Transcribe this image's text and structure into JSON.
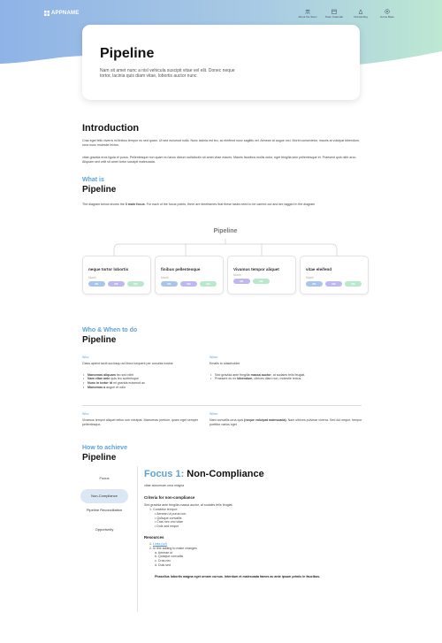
{
  "brand": {
    "name": "APPNAME"
  },
  "nav": [
    {
      "label": "About the Team",
      "icon": "team-icon"
    },
    {
      "label": "Team Calendar",
      "icon": "calendar-icon"
    },
    {
      "label": "Onboarding",
      "icon": "onboarding-icon"
    },
    {
      "label": "Home Base",
      "icon": "home-base-icon"
    }
  ],
  "colors": {
    "hero_start": "#8fb3e6",
    "hero_end": "#bde8d2",
    "accent": "#5ba3d6",
    "pill_m1": "#a8c6ec",
    "pill_m2": "#bdb8f0",
    "pill_m3": "#b9e8cd"
  },
  "hero": {
    "title": "Pipeline",
    "subtitle": "Nam sit amet nunc a nisl vehicula suscipit vitae vel elit. Donec neque tortor, lacinia quis diam vitae, lobortis auctor nunc"
  },
  "intro": {
    "heading": "Introduction",
    "p1": "Cras eget felis viverra mi finibus tempor eu sed quam. Ut sed euismod nulla. Nunc lacinia est leo, ac eleifend nunc sagittis vel. Aenean at augue orci. Morbi consectetur, mauris at volutpat bibendum, urna nunc molestie lectus.",
    "p2": "vitae gravida eros ligula et purus. Pellentesque non quam eu lacus dictum sollicitudin sit amet vitae mauris. Mauris faucibus mollis dolor, eget fringilla sem pellentesque et. Praesent quis nibh arcu. Aliquam sed velit sit amet tortor suscipit malesuada."
  },
  "what": {
    "eyebrow": "What is",
    "heading": "Pipeline",
    "desc_pre": "The diagram below shows the ",
    "desc_bold": "3 main focus",
    "desc_post": ". For each of the focus points, there are timeframes that these tasks need to be carried out and are tagged in the diagram",
    "tree_title": "Pipeline",
    "month_label": "Month",
    "focus": [
      {
        "title": "neque tortor lobortis",
        "pills": [
          "M1",
          "M2",
          "M3"
        ]
      },
      {
        "title": "finibus pellentesque",
        "pills": [
          "M1",
          "M2",
          "M3"
        ]
      },
      {
        "title": "Vivamus tempor aliquet",
        "pills": [
          "M1",
          "M2"
        ]
      },
      {
        "title": "vitae eleifend",
        "pills": [
          "M1",
          "M2",
          "M3"
        ]
      }
    ]
  },
  "who": {
    "eyebrow": "Who & When to do",
    "heading": "Pipeline",
    "left1": {
      "label": "Who:",
      "text": "Class aptent taciti sociosqu ad litora torquent per conubia nostra:",
      "bullets": [
        {
          "bold": "Maecenas aliquam",
          "rest": " leo sed nibh"
        },
        {
          "bold": "Nam vitae ante",
          "rest": " quis leo scelerisque"
        },
        {
          "bold": "Nunc in tortor id",
          "rest": " mi gravida euismod ac"
        },
        {
          "bold": "Maecenas a",
          "rest": " augue et odio"
        }
      ]
    },
    "right1": {
      "label": "When:",
      "text": "Emails to stakeholder",
      "b1_pre": "Sed gravida ante fringilla ",
      "b1_bold": "massa auctor",
      "b1_post": ", at sodales felis feugiat.",
      "b2_pre": "Praesent eu ex ",
      "b2_bold": "bibendum",
      "b2_post": ", ultrices diam non, molestie lectus."
    },
    "left2": {
      "label": "Who:",
      "text": "Vivamus tempor aliquet tellus non volutpat. Maecenas pretium, quam eget semper pellentesque,"
    },
    "right2": {
      "label": "When:",
      "pre": "Nam convallis urna quis ",
      "bold": "(neque volutpat malesuada)",
      "post": ". Nam ultrices pulvinar viverra. Sed dui neque, tempor porttitor varius eget"
    }
  },
  "how": {
    "eyebrow": "How to achieve",
    "heading": "Pipeline",
    "sidenav": [
      "Focus",
      "Non-Compliance",
      "Pipeline Reconciliation",
      "Opportunity"
    ],
    "detail": {
      "title_accent": "Focus 1:",
      "title_rest": " Non-Compliance",
      "intro": "vitae accumsan urna magna",
      "criteria_heading": "Criteria for non-compliance",
      "criteria_text": "Sed gravida ante fringilla massa auctor, at sodales felis feugiat.",
      "criteria_list": [
        "1. Curabitur tempor:"
      ],
      "sub_list": [
        "Aenean ut purus non",
        "Quisque convallis",
        "Cras nec orci vitae",
        "Duis sed neque"
      ],
      "resources_heading": "Resources",
      "resources": [
        {
          "prefix": "1. ",
          "text": "Links (url)",
          "link": true
        },
        {
          "prefix": "2. ",
          "text": "In line adding to make changes",
          "link": false
        }
      ],
      "res_sub": [
        "a. Aenean ut",
        "b. Quisque convallis",
        "c. Cras nec",
        "d. Duis sed"
      ],
      "footer": "Phasellus lobortis magna eget ornare cursus. Interdum et malesuada fames ac ante ipsum primis in faucibus."
    }
  }
}
